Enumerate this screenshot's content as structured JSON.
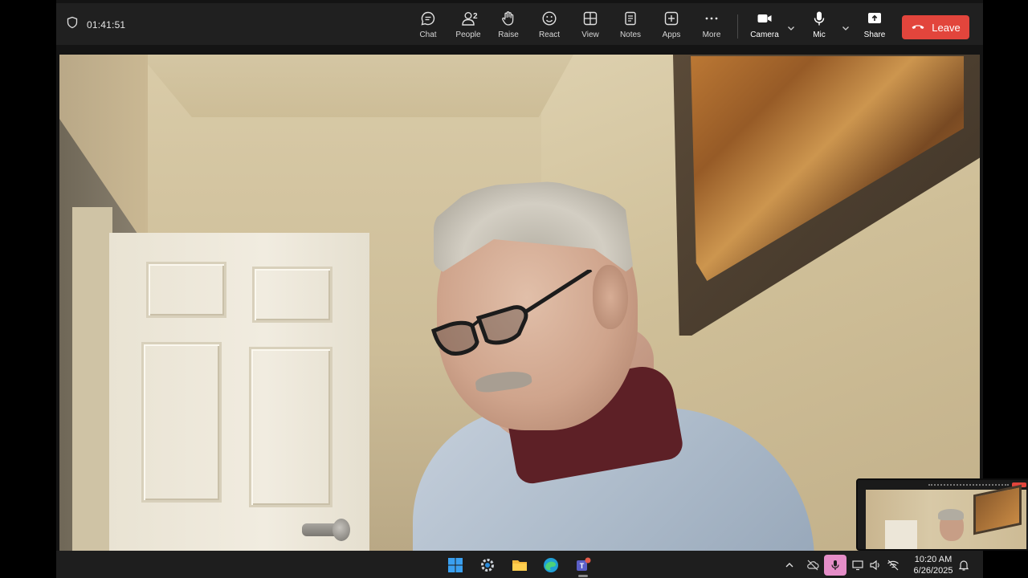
{
  "meeting": {
    "timer": "01:41:51"
  },
  "toolbar": {
    "chat_label": "Chat",
    "people_label": "People",
    "people_count": "2",
    "raise_label": "Raise",
    "react_label": "React",
    "view_label": "View",
    "notes_label": "Notes",
    "apps_label": "Apps",
    "more_label": "More",
    "camera_label": "Camera",
    "mic_label": "Mic",
    "share_label": "Share",
    "leave_label": "Leave"
  },
  "colors": {
    "toolbar_bg": "#202020",
    "leave_red": "#e2453c",
    "mic_tray_pink": "#e58ec8"
  },
  "taskbar": {
    "apps": [
      "windows-start-icon",
      "settings-icon",
      "file-explorer-icon",
      "edge-browser-icon",
      "teams-icon"
    ],
    "tray": [
      "chevron-up-icon",
      "cloud-offline-icon",
      "microphone-icon",
      "display-icon",
      "speaker-icon",
      "network-icon",
      "notification-icon"
    ],
    "time": "10:20 AM",
    "date": "6/26/2025"
  }
}
